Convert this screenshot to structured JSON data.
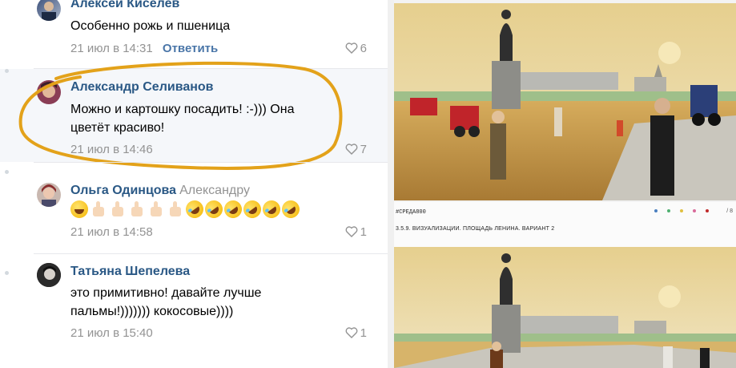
{
  "comments": [
    {
      "author": "Алексей Киселев",
      "reply_to": "",
      "text_lines": [
        "Особенно рожь и пшеница"
      ],
      "date": "21 июл в 14:31",
      "reply_label": "Ответить",
      "likes": "6"
    },
    {
      "author": "Александр Селиванов",
      "reply_to": "",
      "text_lines": [
        "Можно и картошку посадить! :-))) Она",
        "цветёт красиво!"
      ],
      "date": "21 июл в 14:46",
      "likes": "7",
      "highlighted": true
    },
    {
      "author": "Ольга Одинцова",
      "reply_to": "Александру",
      "text_lines": [],
      "emoji": [
        "laughing",
        "thumbs-up",
        "thumbs-up",
        "thumbs-up",
        "thumbs-up",
        "thumbs-up",
        "rofl",
        "rofl",
        "rofl",
        "rofl",
        "rofl",
        "rofl"
      ],
      "date": "21 июл в 14:58",
      "likes": "1"
    },
    {
      "author": "Татьяна Шепелева",
      "reply_to": "",
      "text_lines": [
        "это примитивно! давайте лучше",
        "пальмы!))))))) кокосовые))))"
      ],
      "date": "21 июл в 15:40",
      "likes": "1"
    }
  ],
  "attachment": {
    "hashtag": "#СРЕДА800",
    "caption": "3.5.9. ВИЗУАЛИЗАЦИИ. ПЛОЩАДЬ ЛЕНИНА. ВАРИАНТ 2",
    "page_mark": "/ 8"
  },
  "colors": {
    "link": "#2a5885",
    "meta": "#939393",
    "highlight_ring": "#e3a21a",
    "sky": "#ead9a4",
    "field": "#c99a45"
  }
}
